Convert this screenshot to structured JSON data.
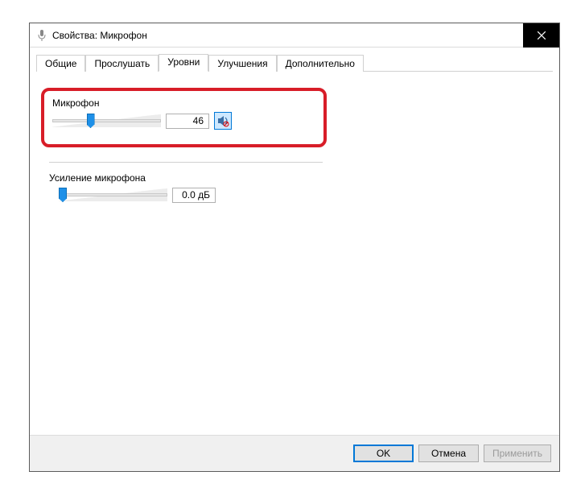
{
  "window": {
    "title": "Свойства: Микрофон"
  },
  "tabs": {
    "general": "Общие",
    "listen": "Прослушать",
    "levels": "Уровни",
    "enhancements": "Улучшения",
    "advanced": "Дополнительно",
    "active": "levels"
  },
  "mic": {
    "label": "Микрофон",
    "value": "46",
    "slider_pos_percent": 34
  },
  "gain": {
    "label": "Усиление микрофона",
    "value": "0.0 дБ",
    "slider_pos_percent": 0
  },
  "buttons": {
    "ok": "OK",
    "cancel": "Отмена",
    "apply": "Применить"
  }
}
